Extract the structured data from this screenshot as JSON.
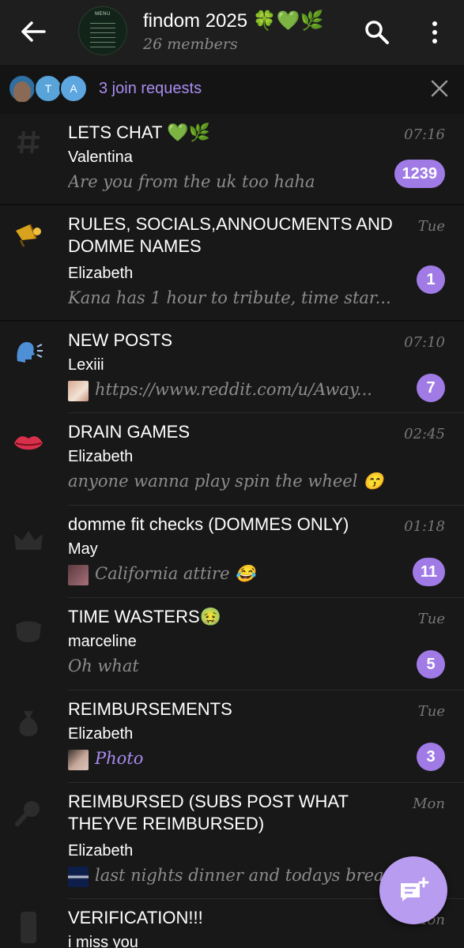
{
  "header": {
    "title": "findom 2025 🍀💚🌿",
    "subtitle": "26 members",
    "avatar_caption": "MENU"
  },
  "join_requests": {
    "label": "3 join requests",
    "avatars": [
      "T",
      "A"
    ]
  },
  "chats": [
    {
      "name": "LETS CHAT 💚🌿",
      "sender": "Valentina",
      "message": "Are you from the uk too haha",
      "time": "07:16",
      "badge": "1239",
      "icon": "hashtag-icon"
    },
    {
      "name": "RULES, SOCIALS,ANNOUCMENTS AND DOMME NAMES",
      "sender": "Elizabeth",
      "message": "Kana has 1 hour to tribute, time star...",
      "time": "Tue",
      "badge": "1",
      "icon": "megaphone-icon"
    },
    {
      "name": "NEW POSTS",
      "sender": "Lexiii",
      "message": "https://www.reddit.com/u/Away...",
      "time": "07:10",
      "badge": "7",
      "icon": "speaking-head-icon"
    },
    {
      "name": "DRAIN GAMES",
      "sender": "Elizabeth",
      "message": "anyone wanna play spin the wheel 😙",
      "time": "02:45",
      "badge": "",
      "icon": "lips-icon"
    },
    {
      "name": "domme fit checks (DOMMES ONLY)",
      "sender": "May",
      "message": "California attire 😂",
      "time": "01:18",
      "badge": "11",
      "icon": "crown-icon"
    },
    {
      "name": "TIME WASTERS🤢",
      "sender": "marceline",
      "message": "Oh what",
      "time": "Tue",
      "badge": "5",
      "icon": "shield-icon"
    },
    {
      "name": "REIMBURSEMENTS",
      "sender": "Elizabeth",
      "message": "Photo",
      "time": "Tue",
      "badge": "3",
      "icon": "money-bag-icon"
    },
    {
      "name": "REIMBURSED (SUBS POST WHAT THEYVE REIMBURSED)",
      "sender": "Elizabeth",
      "message": "last nights dinner and todays brea...",
      "time": "Mon",
      "badge": "",
      "icon": "search-icon"
    },
    {
      "name": "VERIFICATION!!!",
      "sender": "i miss you",
      "message": "",
      "time": "Mon",
      "badge": "",
      "icon": "phone-icon"
    }
  ],
  "colors": {
    "accent": "#a07be6",
    "fab": "#b89cf0",
    "background": "#181818"
  }
}
